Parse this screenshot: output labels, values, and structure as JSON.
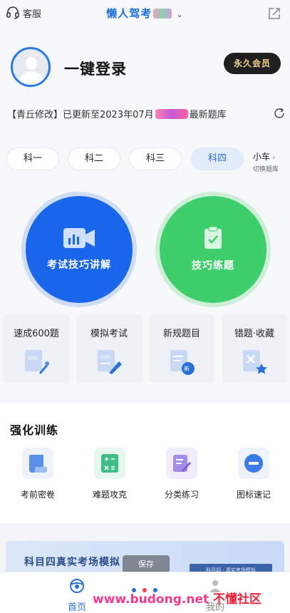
{
  "header": {
    "service_label": "客服",
    "app_title": "懒人驾考",
    "title_suffix": "",
    "icons": {
      "service": "headset-icon",
      "share": "share-icon"
    }
  },
  "profile": {
    "login_label": "一键登录",
    "vip_label": "永久会员"
  },
  "notice": {
    "text_before": "【青丘修改】已更新至2023年07月",
    "text_after": "最新题库"
  },
  "subjects": {
    "tabs": [
      {
        "label": "科一",
        "active": false
      },
      {
        "label": "科二",
        "active": false
      },
      {
        "label": "科三",
        "active": false
      },
      {
        "label": "科四",
        "active": true
      }
    ],
    "vehicle": "小车",
    "switch_label": "切换题库"
  },
  "hero": {
    "left_label": "考试技巧讲解",
    "right_label": "技巧练题",
    "colors": {
      "blue": "#1a66ea",
      "green": "#3ecf6c"
    }
  },
  "features": [
    {
      "label": "速成600题",
      "icon": "rocket-document-icon"
    },
    {
      "label": "模拟考试",
      "icon": "pen-document-icon"
    },
    {
      "label": "新规题目",
      "icon": "new-document-icon"
    },
    {
      "label": "错题·收藏",
      "icon": "star-document-icon"
    }
  ],
  "training": {
    "title": "强化训练",
    "items": [
      {
        "label": "考前密卷",
        "icon": "scroll-icon"
      },
      {
        "label": "难题攻克",
        "icon": "calculator-icon"
      },
      {
        "label": "分类练习",
        "icon": "edit-note-icon"
      },
      {
        "label": "图标速记",
        "icon": "minus-circle-icon"
      }
    ]
  },
  "banner": {
    "title": "科目四真实考场模拟",
    "sim_text": "科目四 · 真实考场模拟"
  },
  "toast": {
    "text": "保存"
  },
  "bottom_nav": {
    "home_label": "首页",
    "mine_label": "我的"
  },
  "watermark": {
    "url": "www.budong.net",
    "site": "不懂社区"
  }
}
